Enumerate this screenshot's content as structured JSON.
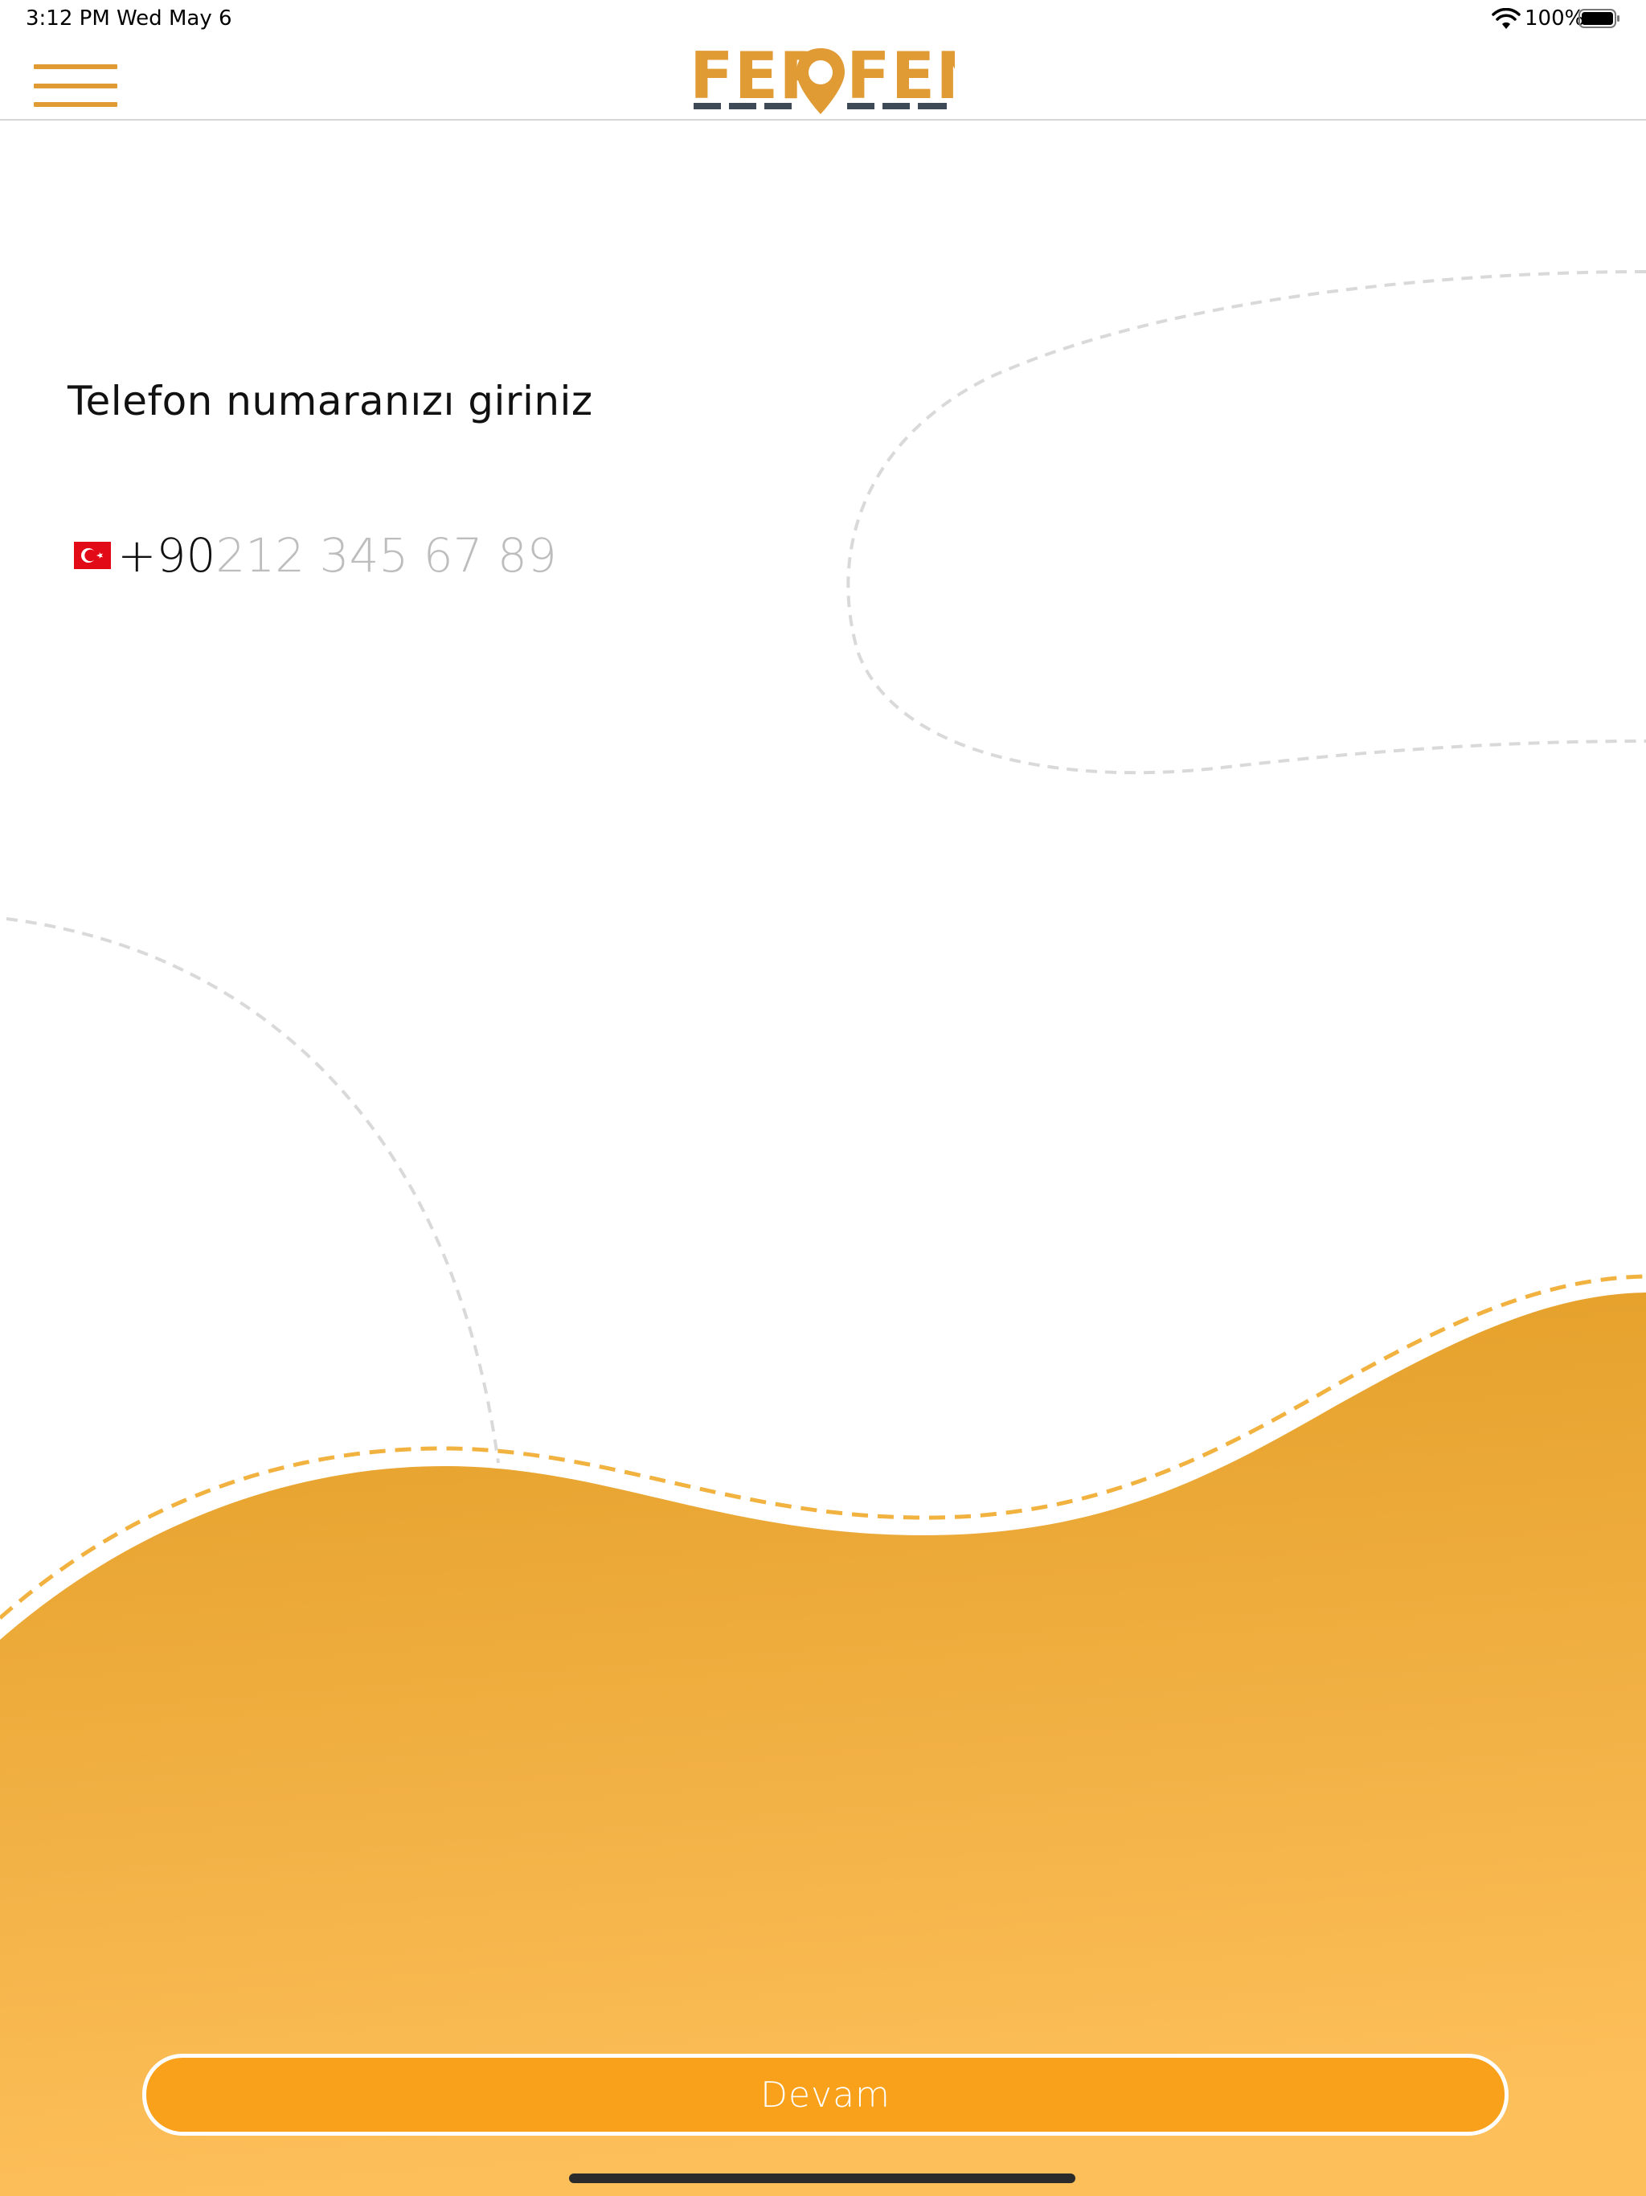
{
  "status_bar": {
    "time": "3:12 PM",
    "date": "Wed May 6",
    "battery": "100%",
    "icons": [
      "wifi-icon",
      "battery-icon"
    ]
  },
  "nav": {
    "menu_icon": "hamburger-menu-icon",
    "logo_text": "FEROFEN"
  },
  "form": {
    "title": "Telefon numaranızı giriniz",
    "country_flag": "turkey-flag-icon",
    "country_code": "+90",
    "phone_value": "",
    "phone_placeholder": "212 345 67 89"
  },
  "actions": {
    "continue_label": "Devam"
  },
  "colors": {
    "brand_orange": "#e09b35",
    "button_orange": "#f9a11b",
    "wave_top": "#e29d25",
    "wave_bottom": "#fdbf5a",
    "logo_dark": "#3e4a55"
  }
}
